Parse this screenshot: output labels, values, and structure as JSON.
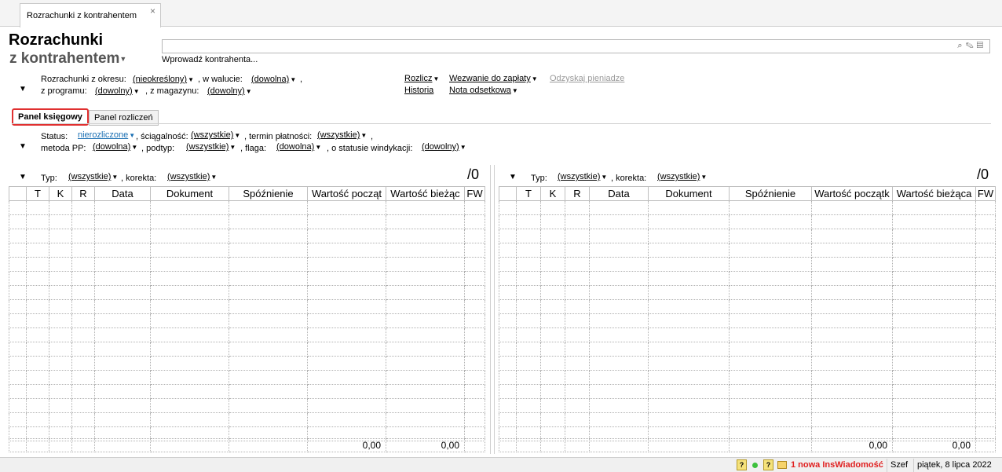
{
  "doc_tab": {
    "label": "Rozrachunki z kontrahentem",
    "close": "×"
  },
  "title": {
    "line1": "Rozrachunki",
    "line2": "z kontrahentem"
  },
  "search": {
    "placeholder": "",
    "prompt": "Wprowadź kontrahenta..."
  },
  "filters": {
    "okres_label": "Rozrachunki z okresu:",
    "okres_value": "(nieokreślony)",
    "waluta_label": ", w walucie:",
    "waluta_value": "(dowolna)",
    "waluta_tail": ",",
    "program_label": "z programu:",
    "program_value": "(dowolny)",
    "magazyn_label": ", z magazynu:",
    "magazyn_value": "(dowolny)"
  },
  "actions": {
    "rozlicz": "Rozlicz",
    "wezwanie": "Wezwanie do zapłaty",
    "odzyskaj": "Odzyskaj pieniadze",
    "historia": "Historia",
    "nota": "Nota odsetkowa"
  },
  "panel_tabs": [
    "Panel księgowy",
    "Panel rozliczeń"
  ],
  "status_filters": {
    "status_label": "Status:",
    "status_value": "nierozliczone",
    "sciag_label": ", ściągalność:",
    "sciag_value": "(wszystkie)",
    "termin_label": ", termin płatności:",
    "termin_value": "(wszystkie)",
    "termin_tail": ",",
    "metoda_label": "metoda PP:",
    "metoda_value": "(dowolna)",
    "podtyp_label": ", podtyp:",
    "podtyp_value": "(wszystkie)",
    "flaga_label": ", flaga:",
    "flaga_value": "(dowolna)",
    "windykacja_label": ", o statusie windykacji:",
    "windykacja_value": "(dowolny)"
  },
  "left_panel": {
    "typ_label": "Typ:",
    "typ_value": "(wszystkie)",
    "korekta_label": ", korekta:",
    "korekta_value": "(wszystkie)",
    "count": "/0",
    "columns": [
      "",
      "T",
      "K",
      "R",
      "Data",
      "Dokument",
      "Spóźnienie",
      "Wartość począt",
      "Wartość bieżąc",
      "FW"
    ],
    "total_start": "0,00",
    "total_current": "0,00"
  },
  "right_panel": {
    "typ_label": "Typ:",
    "typ_value": "(wszystkie)",
    "korekta_label": ", korekta:",
    "korekta_value": "(wszystkie)",
    "count": "/0",
    "columns": [
      "",
      "T",
      "K",
      "R",
      "Data",
      "Dokument",
      "Spóźnienie",
      "Wartość początk",
      "Wartość bieżąca",
      "FW"
    ],
    "total_start": "0,00",
    "total_current": "0,00"
  },
  "statusbar": {
    "q1": "?",
    "q2": "?",
    "notification": "1 nowa InsWiadomość",
    "user": "Szef",
    "date": "piątek, 8 lipca 2022"
  },
  "colors": {
    "notification": "#e02020",
    "active_tab_border": "#e03030",
    "link_blue": "#1a6fb3"
  }
}
